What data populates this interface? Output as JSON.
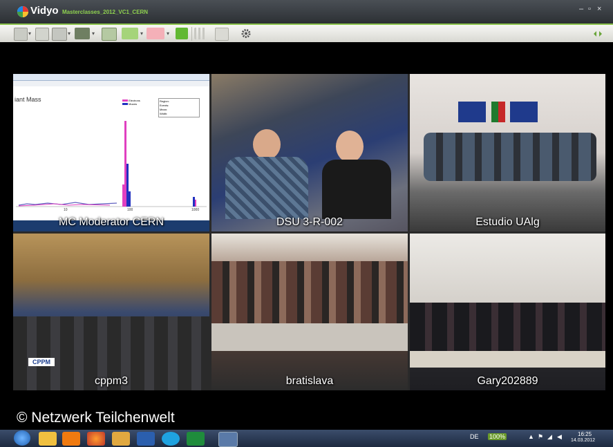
{
  "window": {
    "app_name": "Vidyo",
    "conference_title": "Masterclasses_2012_VC1_CERN",
    "controls": [
      "–",
      "▫",
      "×"
    ]
  },
  "toolbar": {
    "icons": [
      "layout-icon",
      "fullscreen-icon",
      "display-icon",
      "share-icon",
      "self-view-icon",
      "speaker-icon",
      "microphone-muted-icon",
      "camera-icon",
      "dialpad-icon",
      "network-icon",
      "settings-icon"
    ],
    "right_icon": "signal-icon"
  },
  "tiles": [
    {
      "label": "MC Moderator CERN",
      "kind": "screen-share",
      "plot": {
        "heading": "iant Mass",
        "legend": [
          "Electrons",
          "Muons"
        ],
        "stats_rows": [
          "Region:",
          "Events:",
          "Mean:",
          "Width:"
        ],
        "axis_ticks": [
          "10",
          "100",
          "1000"
        ]
      }
    },
    {
      "label": "DSU 3-R-002",
      "kind": "camera"
    },
    {
      "label": "Estudio UAlg",
      "kind": "camera"
    },
    {
      "label": "cppm3",
      "kind": "camera",
      "placard": "CPPM"
    },
    {
      "label": "bratislava",
      "kind": "camera"
    },
    {
      "label": "Gary202889",
      "kind": "camera"
    }
  ],
  "watermark": "© Netzwerk Teilchenwelt",
  "taskbar": {
    "apps": [
      "windows-start-icon",
      "explorer-icon",
      "vlc-icon",
      "firefox-icon",
      "photos-icon",
      "word-icon",
      "skype-icon",
      "excel-icon",
      "vidyo-icon"
    ],
    "language": "DE",
    "battery": "100%",
    "time": "16:25",
    "date": "14.03.2012"
  },
  "colors": {
    "accent": "#8bc34a",
    "title_text": "#8fd14f",
    "taskbar": "#1d2a40"
  }
}
